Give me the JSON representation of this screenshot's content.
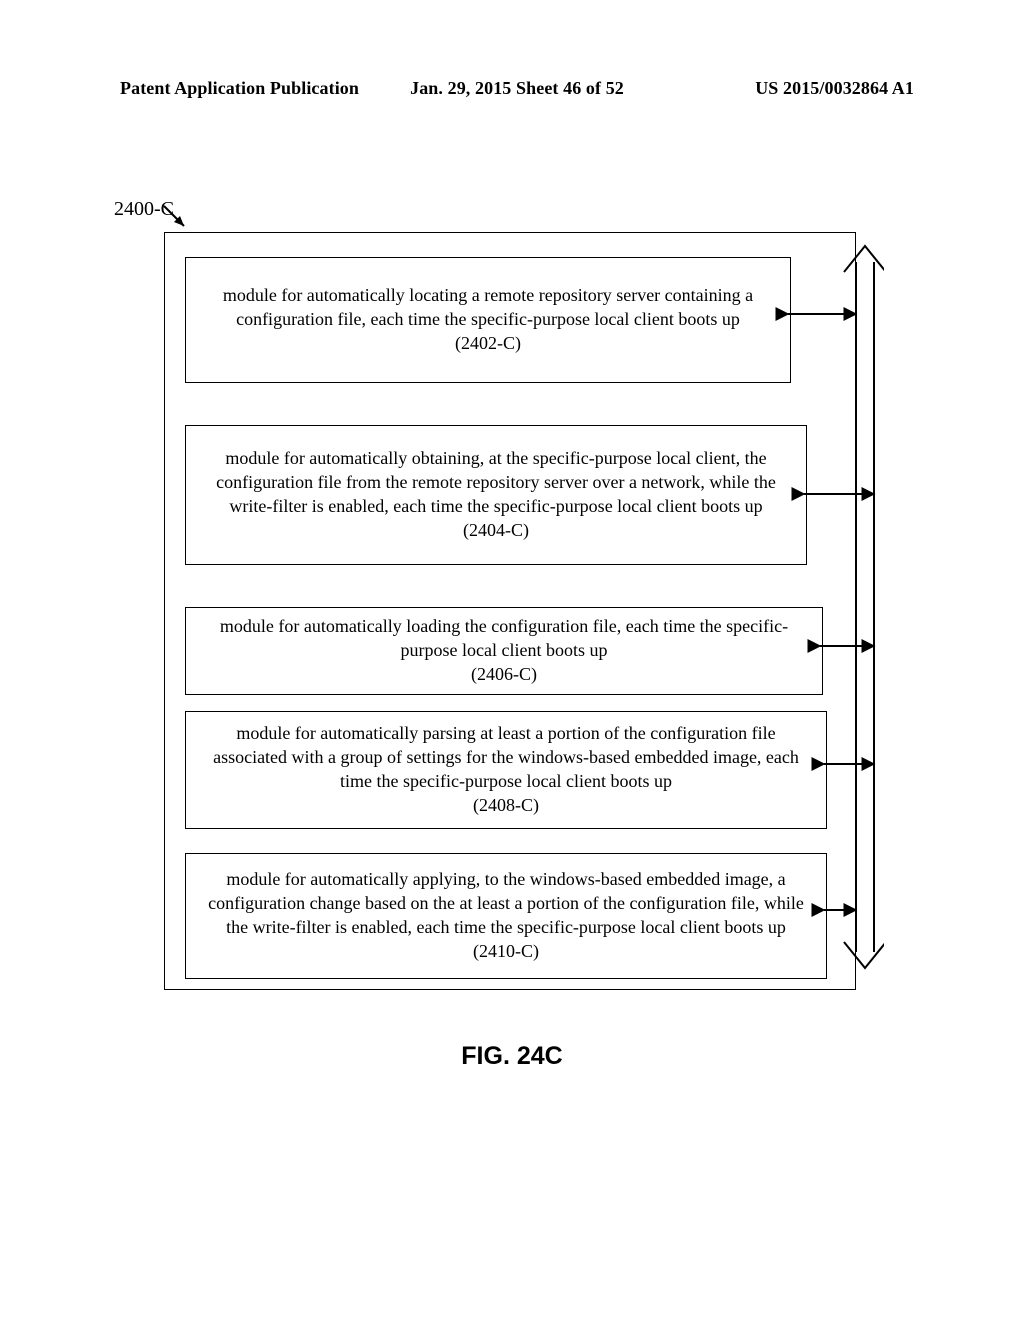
{
  "header": {
    "left": "Patent Application Publication",
    "center": "Jan. 29, 2015  Sheet 46 of 52",
    "right": "US 2015/0032864 A1"
  },
  "reference": "2400-C",
  "modules": [
    {
      "text": "module for automatically locating a remote repository server containing a configuration file, each time the specific-purpose local client boots up",
      "number": "(2402-C)"
    },
    {
      "text": "module for automatically obtaining, at the specific-purpose local client, the configuration file from the remote repository server over a network, while the write-filter is enabled, each time the specific-purpose local client boots up",
      "number": "(2404-C)"
    },
    {
      "text": "module for automatically loading the configuration file, each time the specific-purpose local client boots up",
      "number": "(2406-C)"
    },
    {
      "text": "module for automatically parsing at least a portion of the configuration file associated with a group of settings for the windows-based embedded image, each time the specific-purpose local client boots up",
      "number": "(2408-C)"
    },
    {
      "text": "module for automatically applying, to the windows-based embedded image, a configuration change based on the at least a portion of the configuration file, while the write-filter is enabled, each time the specific-purpose local client boots up",
      "number": "(2410-C)"
    }
  ],
  "figure_caption": "FIG. 24C"
}
